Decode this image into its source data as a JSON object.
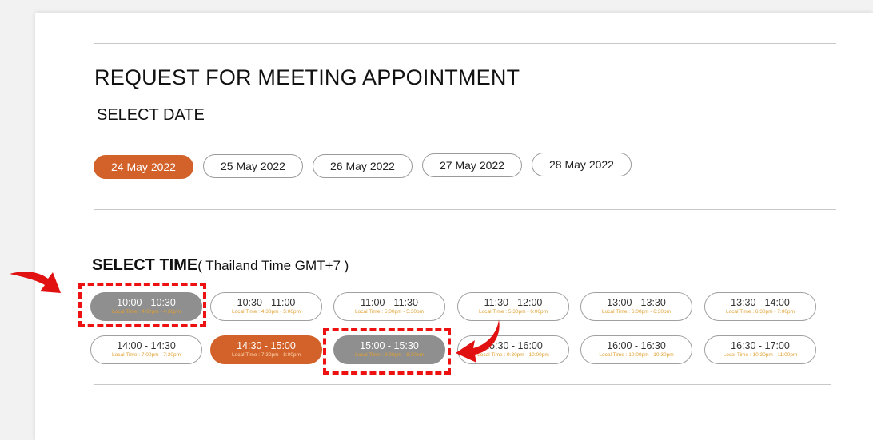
{
  "title": "REQUEST FOR MEETING APPOINTMENT",
  "select_date_label": "SELECT DATE",
  "dates": [
    {
      "label": "24 May 2022",
      "selected": true
    },
    {
      "label": "25 May 2022",
      "selected": false
    },
    {
      "label": "26 May 2022",
      "selected": false
    },
    {
      "label": "27 May 2022",
      "selected": false
    },
    {
      "label": "28 May 2022",
      "selected": false
    }
  ],
  "select_time_label": "SELECT TIME",
  "timezone_label": "( Thailand Time GMT+7 )",
  "slots": [
    {
      "time": "10:00 - 10:30",
      "local": "Local Time : 4:00pm - 4:30pm",
      "state": "unavailable"
    },
    {
      "time": "10:30 - 11:00",
      "local": "Local Time : 4:30pm - 5:00pm",
      "state": "available"
    },
    {
      "time": "11:00 - 11:30",
      "local": "Local Time : 5:00pm - 5:30pm",
      "state": "available"
    },
    {
      "time": "11:30 - 12:00",
      "local": "Local Time : 5:30pm - 6:00pm",
      "state": "available"
    },
    {
      "time": "13:00 - 13:30",
      "local": "Local Time : 6:00pm - 6:30pm",
      "state": "available"
    },
    {
      "time": "13:30 - 14:00",
      "local": "Local Time : 6:30pm - 7:00pm",
      "state": "available"
    },
    {
      "time": "14:00 - 14:30",
      "local": "Local Time : 7:00pm - 7:30pm",
      "state": "available"
    },
    {
      "time": "14:30 - 15:00",
      "local": "Local Time : 7:30pm - 8:00pm",
      "state": "selected"
    },
    {
      "time": "15:00 - 15:30",
      "local": "Local Time : 8:00pm - 8:30pm",
      "state": "unavailable"
    },
    {
      "time": "15:30 - 16:00",
      "local": "Local Time : 9:30pm - 10:00pm",
      "state": "available"
    },
    {
      "time": "16:00 - 16:30",
      "local": "Local Time : 10:00pm - 10:30pm",
      "state": "available"
    },
    {
      "time": "16:30 - 17:00",
      "local": "Local Time : 10:30pm - 11:00pm",
      "state": "available"
    }
  ],
  "colors": {
    "accent": "#d2622a",
    "unavailable": "#8f8f8f",
    "annotation": "#e11111",
    "local_time": "#e0a030"
  }
}
